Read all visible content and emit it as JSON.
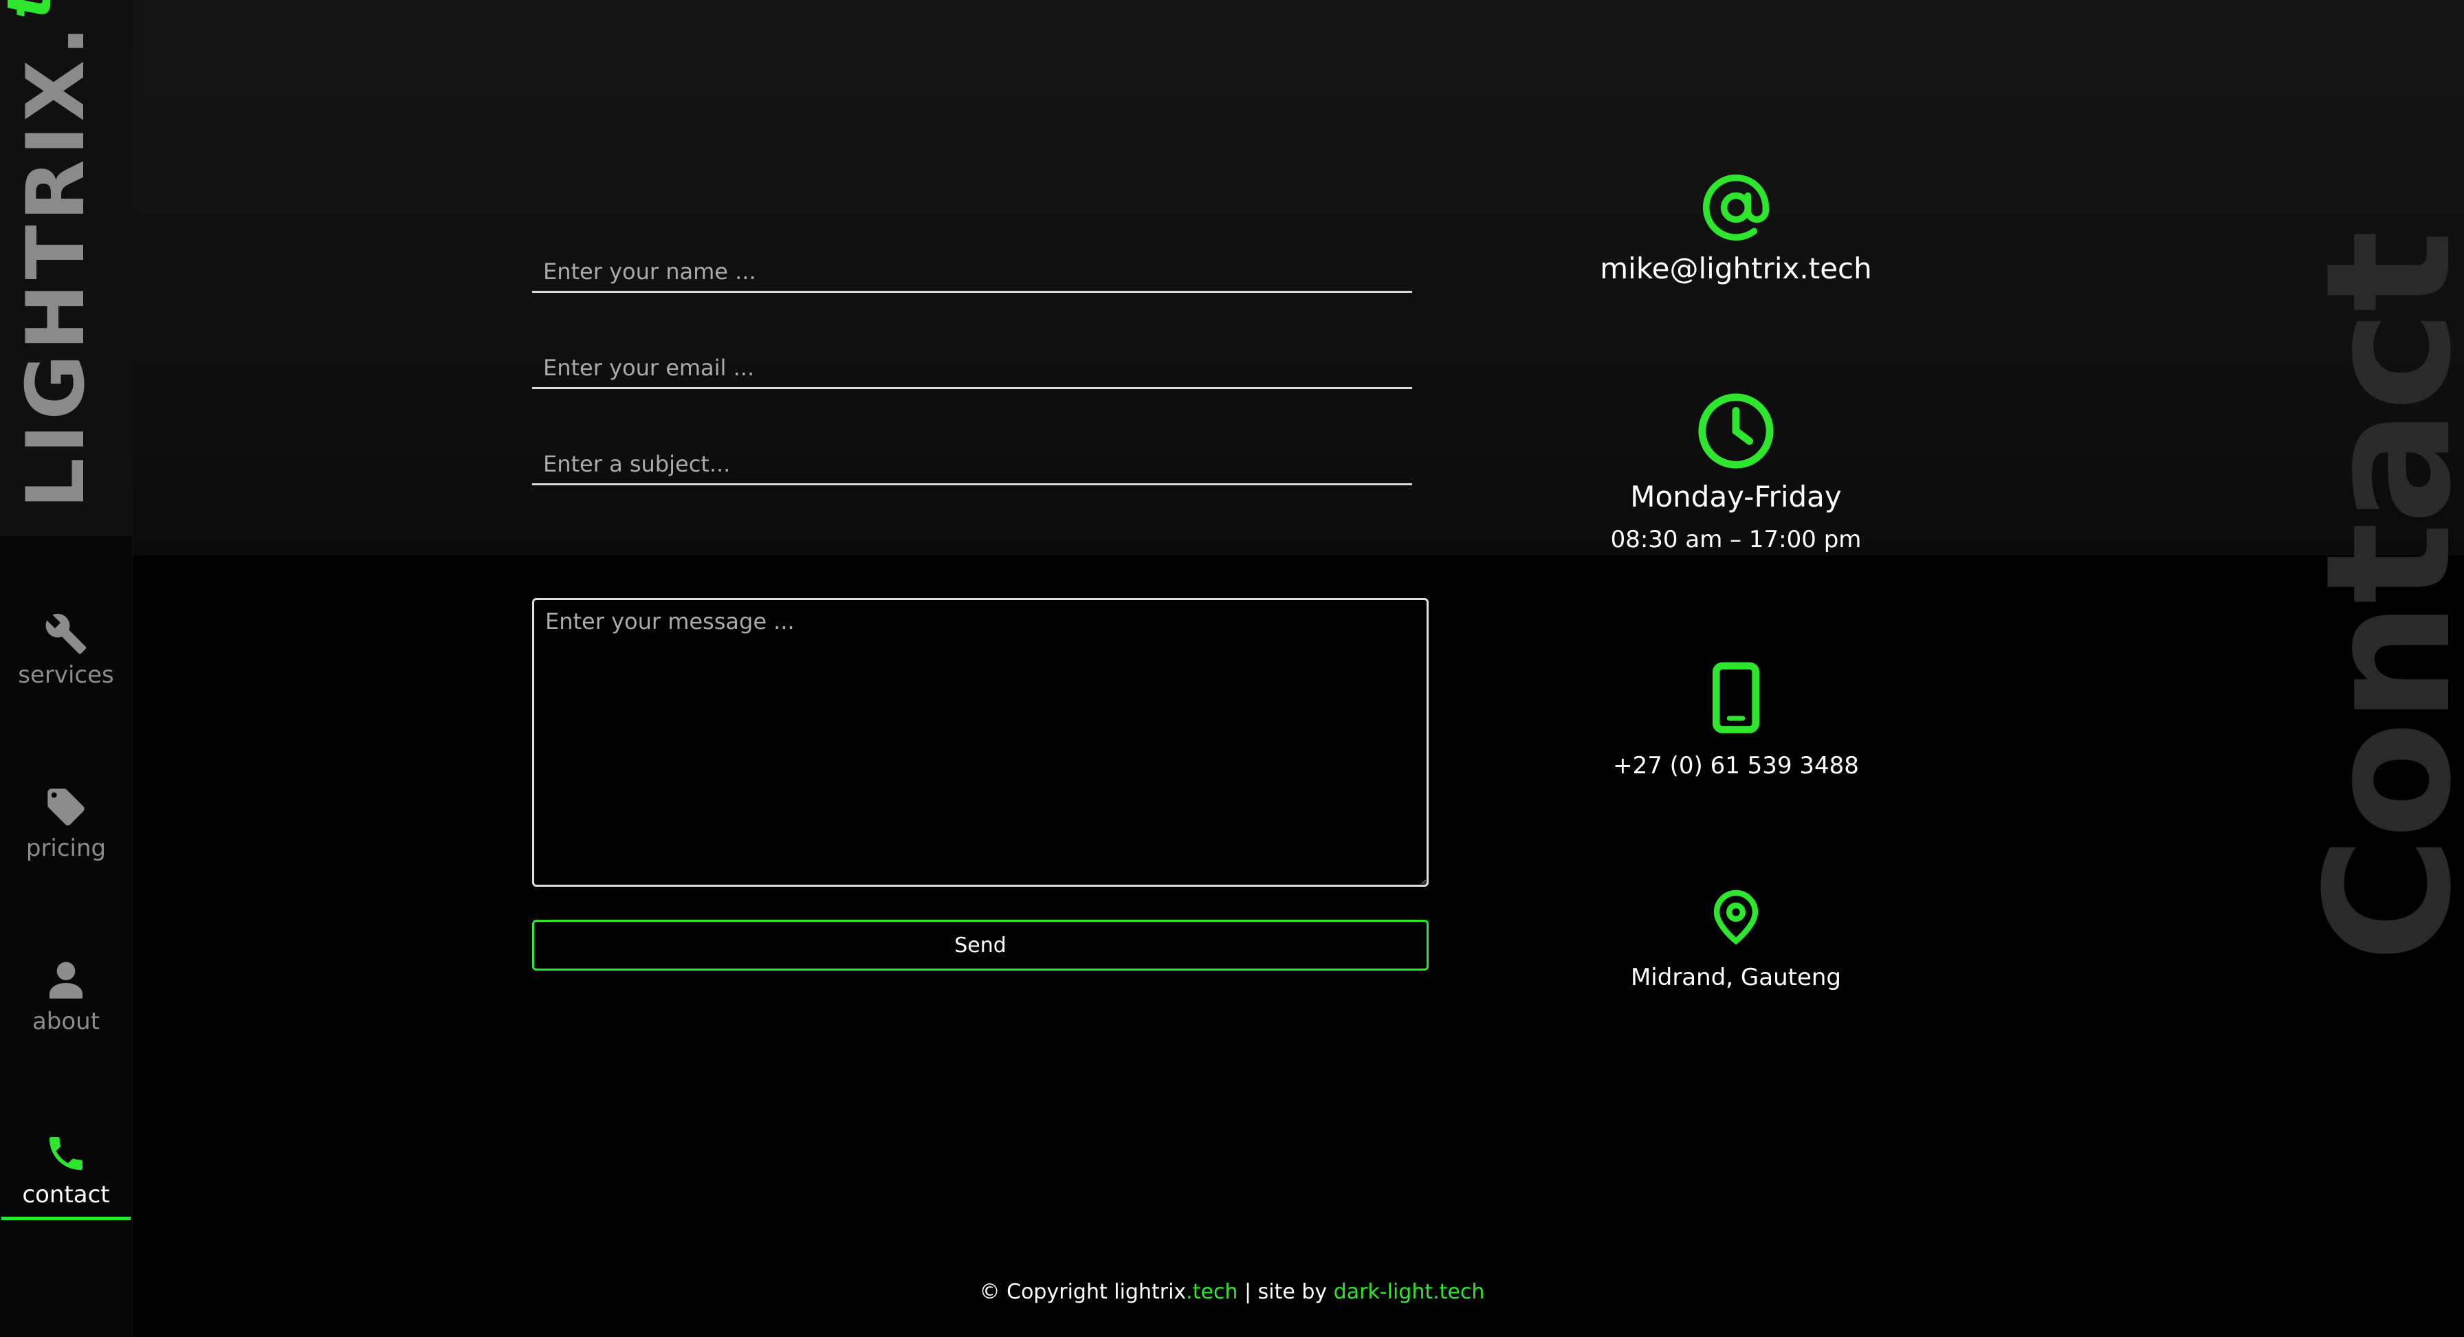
{
  "brand": {
    "main": "LIGHTRIX",
    "dot": ".",
    "suffix": "tech"
  },
  "nav": {
    "items": [
      {
        "id": "services",
        "label": "services",
        "icon": "wrench-icon"
      },
      {
        "id": "pricing",
        "label": "pricing",
        "icon": "tag-icon"
      },
      {
        "id": "about",
        "label": "about",
        "icon": "user-icon"
      },
      {
        "id": "contact",
        "label": "contact",
        "icon": "phone-icon",
        "active": true
      }
    ]
  },
  "form": {
    "name_placeholder": "Enter your name ...",
    "email_placeholder": "Enter your email ...",
    "subject_placeholder": "Enter a subject...",
    "message_placeholder": "Enter your message ...",
    "send_label": "Send"
  },
  "info": {
    "email": "mike@lightrix.tech",
    "hours_days": "Monday-Friday",
    "hours_time": "08:30 am – 17:00 pm",
    "phone": "+27 (0) 61 539 3488",
    "location": "Midrand, Gauteng"
  },
  "watermark": "Contact",
  "footer": {
    "prefix": "© Copyright lightrix",
    "brand_suffix": ".tech",
    "middle": " | site by ",
    "credit": "dark-light.tech"
  },
  "colors": {
    "accent": "#2ee62e",
    "background": "#000000",
    "muted": "#8c8c8c"
  }
}
